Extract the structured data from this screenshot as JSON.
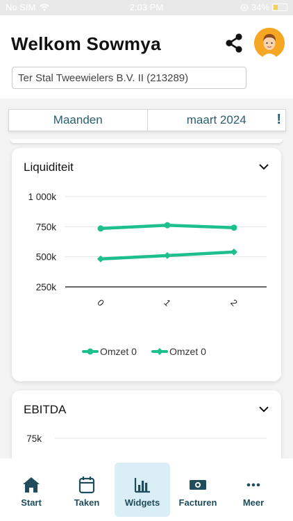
{
  "status_bar": {
    "carrier": "No SIM",
    "time": "2:03 PM",
    "battery": "34%",
    "battery_level": 0.34
  },
  "header": {
    "title": "Welkom Sowmya",
    "company": "Ter Stal Tweewielers B.V. II (213289)"
  },
  "filter": {
    "period_type": "Maanden",
    "period": "maart 2024",
    "alert": "!"
  },
  "cards": [
    {
      "title": "Liquiditeit"
    },
    {
      "title": "EBITDA"
    }
  ],
  "chart_data": [
    {
      "type": "line",
      "title": "Liquiditeit",
      "categories": [
        "0",
        "1",
        "2"
      ],
      "series": [
        {
          "name": "Omzet 0",
          "values": [
            735000,
            762000,
            742000
          ],
          "color": "#1dc08c",
          "marker": "circle"
        },
        {
          "name": "Omzet 0",
          "values": [
            482000,
            510000,
            540000
          ],
          "color": "#1dc08c",
          "marker": "diamond"
        }
      ],
      "ylim": [
        250000,
        1000000
      ],
      "yticks": [
        250000,
        500000,
        750000,
        1000000
      ],
      "ytick_labels": [
        "250k",
        "500k",
        "750k",
        "1 000k"
      ],
      "grid": true,
      "legend_position": "bottom"
    },
    {
      "type": "line",
      "title": "EBITDA",
      "ytick_labels": [
        "75k"
      ]
    }
  ],
  "nav": [
    {
      "label": "Start",
      "icon": "home-icon",
      "active": false
    },
    {
      "label": "Taken",
      "icon": "calendar-icon",
      "active": false
    },
    {
      "label": "Widgets",
      "icon": "bar-chart-icon",
      "active": true
    },
    {
      "label": "Facturen",
      "icon": "banknote-icon",
      "active": false
    },
    {
      "label": "Meer",
      "icon": "more-icon",
      "active": false
    }
  ],
  "colors": {
    "accent": "#1dc08c",
    "brand": "#2b5f6e",
    "nav_active_bg": "#d9eef5"
  }
}
